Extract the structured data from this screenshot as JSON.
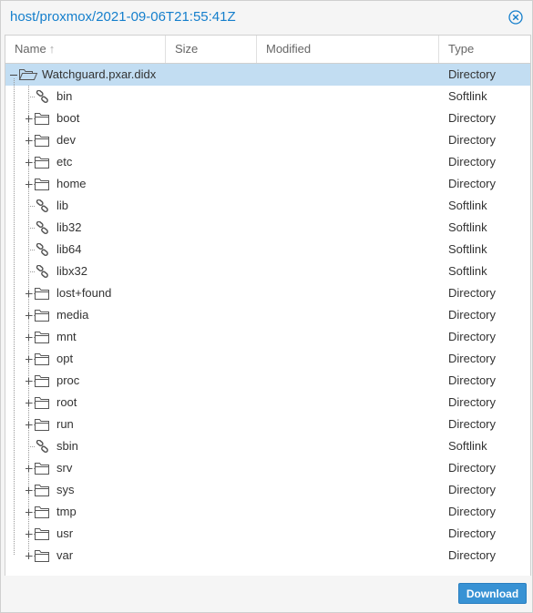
{
  "window": {
    "title": "host/proxmox/2021-09-06T21:55:41Z"
  },
  "columns": {
    "name": "Name",
    "size": "Size",
    "modified": "Modified",
    "type": "Type",
    "sort_indicator": "↑"
  },
  "root": {
    "name": "Watchguard.pxar.didx",
    "type": "Directory",
    "icon": "folder-open-icon",
    "expanded": true,
    "selected": true
  },
  "entries": [
    {
      "name": "bin",
      "type": "Softlink",
      "icon": "link-icon",
      "expandable": false
    },
    {
      "name": "boot",
      "type": "Directory",
      "icon": "folder-icon",
      "expandable": true
    },
    {
      "name": "dev",
      "type": "Directory",
      "icon": "folder-icon",
      "expandable": true
    },
    {
      "name": "etc",
      "type": "Directory",
      "icon": "folder-icon",
      "expandable": true
    },
    {
      "name": "home",
      "type": "Directory",
      "icon": "folder-icon",
      "expandable": true
    },
    {
      "name": "lib",
      "type": "Softlink",
      "icon": "link-icon",
      "expandable": false
    },
    {
      "name": "lib32",
      "type": "Softlink",
      "icon": "link-icon",
      "expandable": false
    },
    {
      "name": "lib64",
      "type": "Softlink",
      "icon": "link-icon",
      "expandable": false
    },
    {
      "name": "libx32",
      "type": "Softlink",
      "icon": "link-icon",
      "expandable": false
    },
    {
      "name": "lost+found",
      "type": "Directory",
      "icon": "folder-icon",
      "expandable": true
    },
    {
      "name": "media",
      "type": "Directory",
      "icon": "folder-icon",
      "expandable": true
    },
    {
      "name": "mnt",
      "type": "Directory",
      "icon": "folder-icon",
      "expandable": true
    },
    {
      "name": "opt",
      "type": "Directory",
      "icon": "folder-icon",
      "expandable": true
    },
    {
      "name": "proc",
      "type": "Directory",
      "icon": "folder-icon",
      "expandable": true
    },
    {
      "name": "root",
      "type": "Directory",
      "icon": "folder-icon",
      "expandable": true
    },
    {
      "name": "run",
      "type": "Directory",
      "icon": "folder-icon",
      "expandable": true
    },
    {
      "name": "sbin",
      "type": "Softlink",
      "icon": "link-icon",
      "expandable": false
    },
    {
      "name": "srv",
      "type": "Directory",
      "icon": "folder-icon",
      "expandable": true
    },
    {
      "name": "sys",
      "type": "Directory",
      "icon": "folder-icon",
      "expandable": true
    },
    {
      "name": "tmp",
      "type": "Directory",
      "icon": "folder-icon",
      "expandable": true
    },
    {
      "name": "usr",
      "type": "Directory",
      "icon": "folder-icon",
      "expandable": true
    },
    {
      "name": "var",
      "type": "Directory",
      "icon": "folder-icon",
      "expandable": true
    }
  ],
  "footer": {
    "download_label": "Download"
  },
  "colors": {
    "accent": "#157fcc",
    "selected_row": "#c2ddf2",
    "button": "#3892d4"
  }
}
